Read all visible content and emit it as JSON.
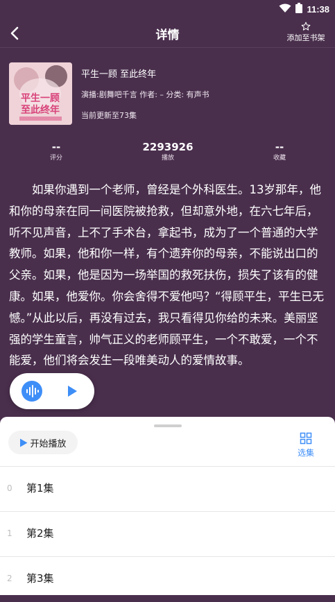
{
  "status_bar": {
    "time": "11:38"
  },
  "header": {
    "title": "详情",
    "add_to_shelf": "添加至书架"
  },
  "book": {
    "title": "平生一顾 至此终年",
    "meta": "演播:剧舞吧千言  作者: –  分类: 有声书",
    "update": "当前更新至73集",
    "cover_title": "平生一顾\n至此终年"
  },
  "stats": [
    {
      "value": "--",
      "label": "评分"
    },
    {
      "value": "2293926",
      "label": "播放"
    },
    {
      "value": "--",
      "label": "收藏"
    }
  ],
  "description": "如果你遇到一个老师，曾经是个外科医生。13岁那年，他和你的母亲在同一间医院被抢救，但却意外地，在六七年后，听不见声音，上不了手术台，拿起书，成为了一个普通的大学教师。如果，他和你一样，有个遗弃你的母亲，不能说出口的父亲。如果，他是因为一场举国的救死扶伤，损失了该有的健康。如果，他爱你。你会舍得不爱他吗？“得顾平生，平生已无憾。”从此以后，再没有过去，我只看得见你给的未来。美丽坚强的学生童言，帅气正义的老师顾平生，一个不敢爱，一个不能爱，他们将会发生一段唯美动人的爱情故事。",
  "sheet": {
    "start_label": "开始播放",
    "select_label": "选集",
    "episodes": [
      {
        "index": "0",
        "name": "第1集"
      },
      {
        "index": "1",
        "name": "第2集"
      },
      {
        "index": "2",
        "name": "第3集"
      }
    ]
  },
  "colors": {
    "background": "#4a2f4d",
    "accent": "#3e8ef7"
  }
}
